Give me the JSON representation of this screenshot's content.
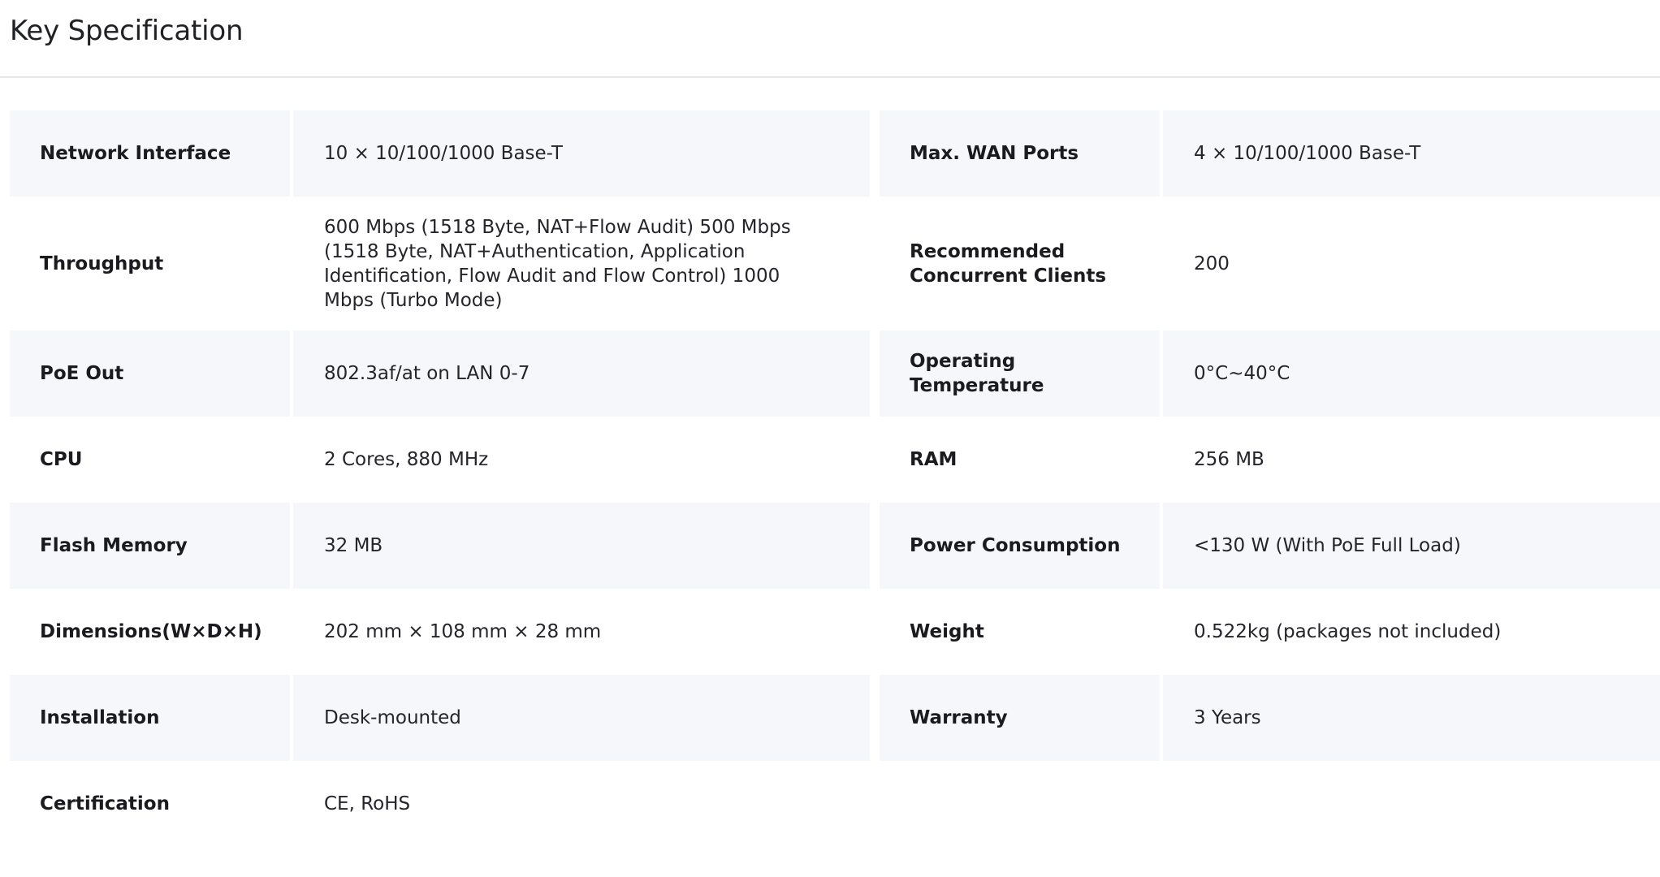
{
  "header": {
    "title": "Key Specification"
  },
  "rows": [
    {
      "left_label": "Network Interface",
      "left_value": "10 × 10/100/1000 Base-T",
      "right_label": "Max. WAN Ports",
      "right_value": "4 × 10/100/1000 Base-T"
    },
    {
      "left_label": "Throughput",
      "left_value": "600 Mbps (1518 Byte, NAT+Flow Audit) 500 Mbps (1518 Byte, NAT+Authentication, Application Identification, Flow Audit and Flow Control) 1000 Mbps (Turbo Mode)",
      "right_label": "Recommended Concurrent Clients",
      "right_value": "200"
    },
    {
      "left_label": "PoE Out",
      "left_value": "802.3af/at on LAN 0-7",
      "right_label": "Operating Temperature",
      "right_value": "0°C~40°C"
    },
    {
      "left_label": "CPU",
      "left_value": "2 Cores, 880 MHz",
      "right_label": "RAM",
      "right_value": "256 MB"
    },
    {
      "left_label": "Flash Memory",
      "left_value": "32 MB",
      "right_label": "Power Consumption",
      "right_value": "<130 W (With PoE Full Load)"
    },
    {
      "left_label": "Dimensions(W×D×H)",
      "left_value": "202 mm × 108 mm × 28 mm",
      "right_label": "Weight",
      "right_value": "0.522kg (packages not included)"
    },
    {
      "left_label": "Installation",
      "left_value": "Desk-mounted",
      "right_label": "Warranty",
      "right_value": "3 Years"
    },
    {
      "left_label": "Certification",
      "left_value": "CE, RoHS",
      "right_label": "",
      "right_value": ""
    }
  ]
}
